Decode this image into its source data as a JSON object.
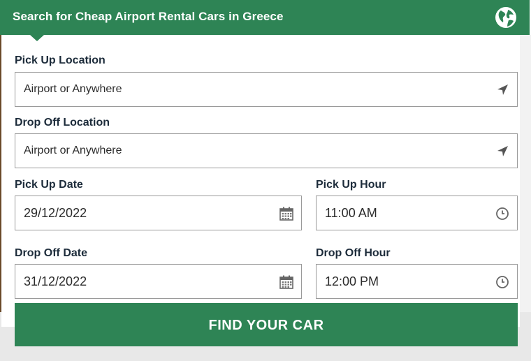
{
  "header": {
    "title": "Search for Cheap Airport Rental Cars in Greece",
    "icon": "globe-icon"
  },
  "colors": {
    "brand_green": "#2e8455",
    "label_text": "#1c2b3a",
    "border": "#9a9a9a"
  },
  "pickup_location": {
    "label": "Pick Up Location",
    "value": "Airport or Anywhere",
    "icon": "location-arrow-icon"
  },
  "dropoff_location": {
    "label": "Drop Off Location",
    "value": "Airport or Anywhere",
    "icon": "location-arrow-icon"
  },
  "pickup_date": {
    "label": "Pick Up Date",
    "value": "29/12/2022",
    "icon": "calendar-icon"
  },
  "pickup_hour": {
    "label": "Pick Up Hour",
    "value": "11:00 AM",
    "icon": "clock-icon"
  },
  "dropoff_date": {
    "label": "Drop Off Date",
    "value": "31/12/2022",
    "icon": "calendar-icon"
  },
  "dropoff_hour": {
    "label": "Drop Off Hour",
    "value": "12:00 PM",
    "icon": "clock-icon"
  },
  "submit": {
    "label": "FIND YOUR CAR"
  }
}
